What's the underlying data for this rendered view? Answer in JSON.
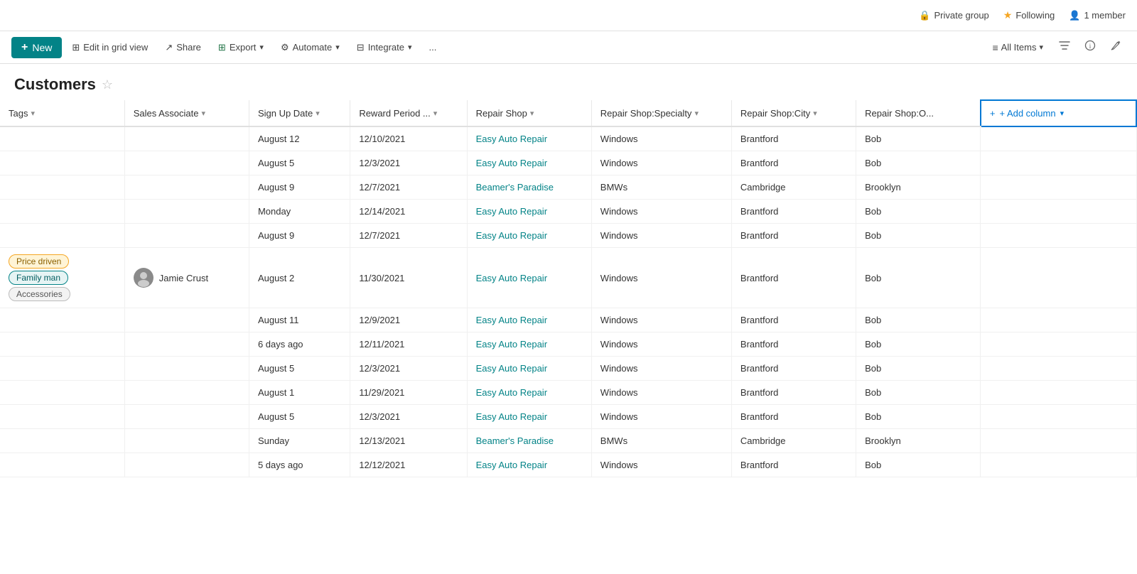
{
  "topbar": {
    "private_group": "Private group",
    "following_label": "Following",
    "member_count": "1 member"
  },
  "toolbar": {
    "new_label": "New",
    "edit_grid": "Edit in grid view",
    "share": "Share",
    "export": "Export",
    "automate": "Automate",
    "integrate": "Integrate",
    "more": "...",
    "view_name": "All Items"
  },
  "page": {
    "title": "Customers"
  },
  "columns": [
    {
      "id": "tags",
      "label": "Tags",
      "has_chevron": true
    },
    {
      "id": "sales_associate",
      "label": "Sales Associate",
      "has_chevron": true
    },
    {
      "id": "sign_up_date",
      "label": "Sign Up Date",
      "has_chevron": true
    },
    {
      "id": "reward_period",
      "label": "Reward Period ...",
      "has_chevron": true
    },
    {
      "id": "repair_shop",
      "label": "Repair Shop",
      "has_chevron": true
    },
    {
      "id": "repair_shop_specialty",
      "label": "Repair Shop:Specialty",
      "has_chevron": true
    },
    {
      "id": "repair_shop_city",
      "label": "Repair Shop:City",
      "has_chevron": true
    },
    {
      "id": "repair_shop_o",
      "label": "Repair Shop:O...",
      "has_chevron": false
    }
  ],
  "add_column_label": "+ Add column",
  "rows": [
    {
      "tags": [],
      "sales_associate": null,
      "sign_up_date": "August 12",
      "reward_period": "12/10/2021",
      "repair_shop": "Easy Auto Repair",
      "specialty": "Windows",
      "city": "Brantford",
      "owner": "Bob"
    },
    {
      "tags": [],
      "sales_associate": null,
      "sign_up_date": "August 5",
      "reward_period": "12/3/2021",
      "repair_shop": "Easy Auto Repair",
      "specialty": "Windows",
      "city": "Brantford",
      "owner": "Bob"
    },
    {
      "tags": [],
      "sales_associate": null,
      "sign_up_date": "August 9",
      "reward_period": "12/7/2021",
      "repair_shop": "Beamer's Paradise",
      "specialty": "BMWs",
      "city": "Cambridge",
      "owner": "Brooklyn"
    },
    {
      "tags": [],
      "sales_associate": null,
      "sign_up_date": "Monday",
      "reward_period": "12/14/2021",
      "repair_shop": "Easy Auto Repair",
      "specialty": "Windows",
      "city": "Brantford",
      "owner": "Bob"
    },
    {
      "tags": [],
      "sales_associate": null,
      "sign_up_date": "August 9",
      "reward_period": "12/7/2021",
      "repair_shop": "Easy Auto Repair",
      "specialty": "Windows",
      "city": "Brantford",
      "owner": "Bob"
    },
    {
      "tags": [
        "Price driven",
        "Family man",
        "Accessories"
      ],
      "sales_associate": "Jamie Crust",
      "sign_up_date": "August 2",
      "reward_period": "11/30/2021",
      "repair_shop": "Easy Auto Repair",
      "specialty": "Windows",
      "city": "Brantford",
      "owner": "Bob"
    },
    {
      "tags": [],
      "sales_associate": null,
      "sign_up_date": "August 11",
      "reward_period": "12/9/2021",
      "repair_shop": "Easy Auto Repair",
      "specialty": "Windows",
      "city": "Brantford",
      "owner": "Bob"
    },
    {
      "tags": [],
      "sales_associate": null,
      "sign_up_date": "6 days ago",
      "reward_period": "12/11/2021",
      "repair_shop": "Easy Auto Repair",
      "specialty": "Windows",
      "city": "Brantford",
      "owner": "Bob"
    },
    {
      "tags": [],
      "sales_associate": null,
      "sign_up_date": "August 5",
      "reward_period": "12/3/2021",
      "repair_shop": "Easy Auto Repair",
      "specialty": "Windows",
      "city": "Brantford",
      "owner": "Bob"
    },
    {
      "tags": [],
      "sales_associate": null,
      "sign_up_date": "August 1",
      "reward_period": "11/29/2021",
      "repair_shop": "Easy Auto Repair",
      "specialty": "Windows",
      "city": "Brantford",
      "owner": "Bob"
    },
    {
      "tags": [],
      "sales_associate": null,
      "sign_up_date": "August 5",
      "reward_period": "12/3/2021",
      "repair_shop": "Easy Auto Repair",
      "specialty": "Windows",
      "city": "Brantford",
      "owner": "Bob"
    },
    {
      "tags": [],
      "sales_associate": null,
      "sign_up_date": "Sunday",
      "reward_period": "12/13/2021",
      "repair_shop": "Beamer's Paradise",
      "specialty": "BMWs",
      "city": "Cambridge",
      "owner": "Brooklyn"
    },
    {
      "tags": [],
      "sales_associate": null,
      "sign_up_date": "5 days ago",
      "reward_period": "12/12/2021",
      "repair_shop": "Easy Auto Repair",
      "specialty": "Windows",
      "city": "Brantford",
      "owner": "Bob"
    }
  ],
  "tag_styles": {
    "Price driven": "tag-yellow",
    "Family man": "tag-teal",
    "Accessories": "tag-gray"
  },
  "colors": {
    "accent": "#038387",
    "link": "#038387",
    "add_col_border": "#0078d4"
  }
}
